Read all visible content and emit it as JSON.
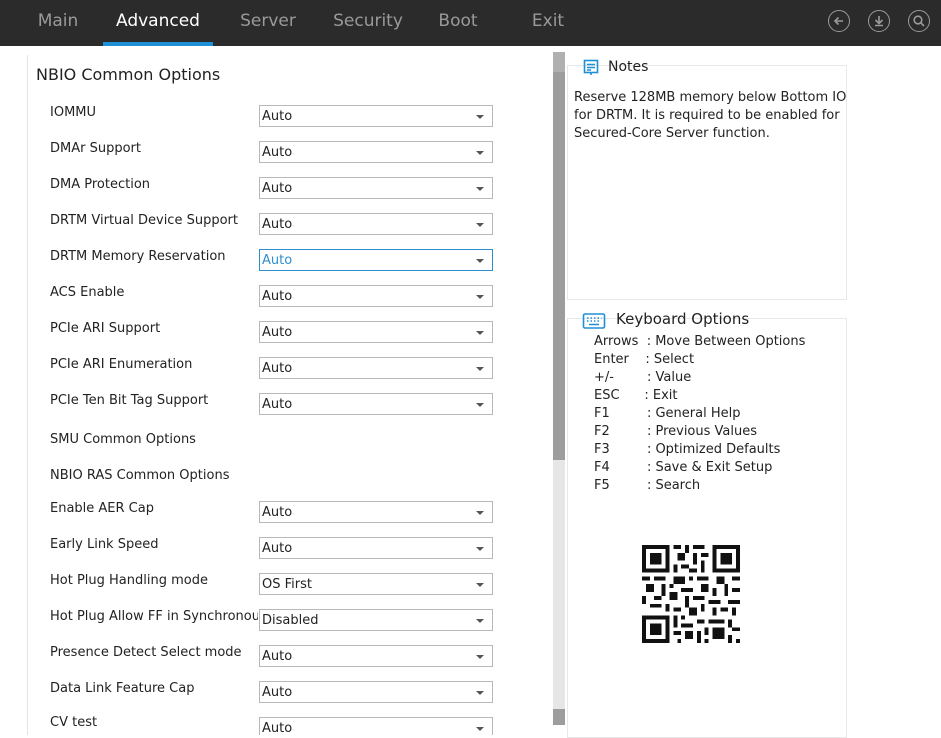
{
  "nav": {
    "tabs": [
      {
        "label": "Main"
      },
      {
        "label": "Advanced"
      },
      {
        "label": "Server"
      },
      {
        "label": "Security"
      },
      {
        "label": "Boot"
      },
      {
        "label": "Exit"
      }
    ],
    "active_tab": "Advanced",
    "icons": [
      "back-icon",
      "download-icon",
      "search-icon"
    ]
  },
  "section_title": "NBIO Common Options",
  "options": [
    {
      "label": "IOMMU",
      "value": "Auto"
    },
    {
      "label": "DMAr Support",
      "value": "Auto"
    },
    {
      "label": "DMA Protection",
      "value": "Auto"
    },
    {
      "label": "DRTM Virtual Device Support",
      "value": "Auto"
    },
    {
      "label": "DRTM Memory Reservation",
      "value": "Auto",
      "focused": true
    },
    {
      "label": "ACS Enable",
      "value": "Auto"
    },
    {
      "label": "PCIe ARI Support",
      "value": "Auto"
    },
    {
      "label": "PCIe ARI Enumeration",
      "value": "Auto"
    },
    {
      "label": "PCIe Ten Bit Tag Support",
      "value": "Auto"
    }
  ],
  "submenus": [
    {
      "label": "SMU Common Options"
    },
    {
      "label": "NBIO RAS Common Options"
    }
  ],
  "options2": [
    {
      "label": "Enable AER Cap",
      "value": "Auto"
    },
    {
      "label": "Early Link Speed",
      "value": "Auto"
    },
    {
      "label": "Hot Plug Handling mode",
      "value": "OS First"
    },
    {
      "label": "Hot Plug Allow FF in Synchronous",
      "value": "Disabled"
    },
    {
      "label": "Presence Detect Select mode",
      "value": "Auto"
    },
    {
      "label": "Data Link Feature Cap",
      "value": "Auto"
    },
    {
      "label": "CV test",
      "value": "Auto"
    }
  ],
  "notes": {
    "title": "Notes",
    "text": "Reserve 128MB memory below Bottom IO for DRTM. It is required to be enabled for Secured-Core Server function."
  },
  "keyboard": {
    "title": "Keyboard Options",
    "rows": [
      "Arrows  : Move Between Options",
      "Enter    : Select",
      "+/-        : Value",
      "ESC      : Exit",
      "F1         : General Help",
      "F2         : Previous Values",
      "F3         : Optimized Defaults",
      "F4         : Save & Exit Setup",
      "F5         : Search"
    ]
  },
  "colors": {
    "topbar": "#2b2b2b",
    "accent": "#1e90d6",
    "focused": "#2f8fce"
  }
}
